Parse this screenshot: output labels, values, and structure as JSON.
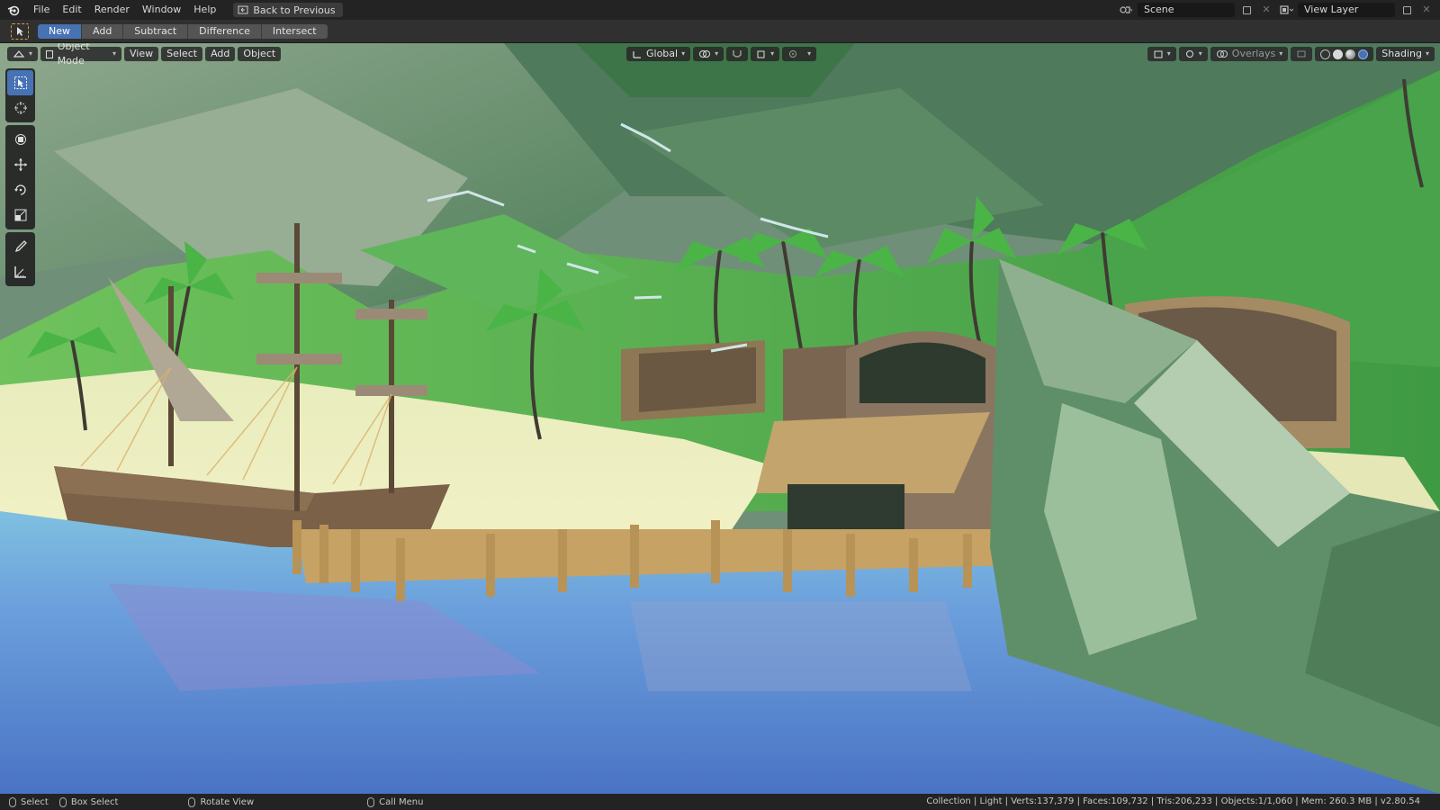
{
  "menu": {
    "items": [
      "File",
      "Edit",
      "Render",
      "Window",
      "Help"
    ],
    "back_label": "Back to Previous"
  },
  "workspace": {
    "scene_name": "Scene",
    "view_layer": "View Layer"
  },
  "boolean_ops": {
    "buttons": [
      "New",
      "Add",
      "Subtract",
      "Difference",
      "Intersect"
    ],
    "active": "New"
  },
  "viewport_header": {
    "mode": "Object Mode",
    "menus": [
      "View",
      "Select",
      "Add",
      "Object"
    ],
    "orientation": "Global",
    "overlays_label": "Overlays",
    "shading_label": "Shading"
  },
  "tools": [
    "select-box",
    "cursor",
    "transform",
    "move",
    "rotate",
    "scale",
    "annotate",
    "measure"
  ],
  "statusbar": {
    "select": "Select",
    "box_select": "Box Select",
    "rotate_view": "Rotate View",
    "call_menu": "Call Menu",
    "stats": "Collection | Light | Verts:137,379 | Faces:109,732 | Tris:206,233 | Objects:1/1,060 | Mem: 260.3 MB | v2.80.54"
  },
  "colors": {
    "accent": "#4772b3",
    "topbar": "#232323",
    "header": "#303030",
    "tool_active_outline": "#d79d3a"
  }
}
